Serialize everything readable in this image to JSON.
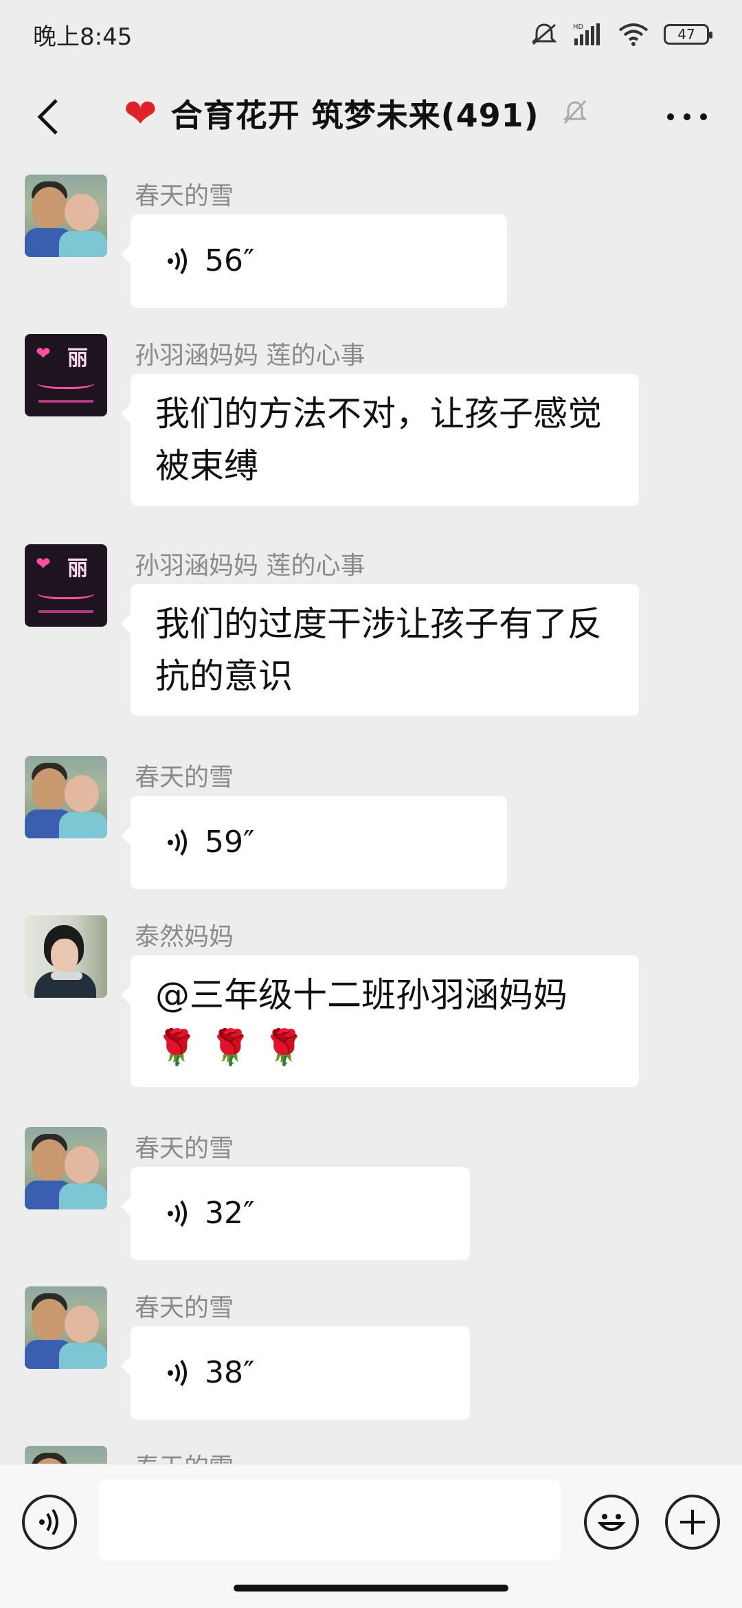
{
  "status_bar": {
    "time": "晚上8:45",
    "battery": "47"
  },
  "header": {
    "title": "合育花开 筑梦未来(491)"
  },
  "messages": [
    {
      "sender": "春天的雪",
      "type": "voice",
      "duration": "56″"
    },
    {
      "sender": "孙羽涵妈妈   莲的心事",
      "type": "text",
      "text": "我们的方法不对，让孩子感觉被束缚"
    },
    {
      "sender": "孙羽涵妈妈   莲的心事",
      "type": "text",
      "text": "我们的过度干涉让孩子有了反抗的意识"
    },
    {
      "sender": "春天的雪",
      "type": "voice",
      "duration": "59″"
    },
    {
      "sender": "泰然妈妈",
      "type": "text",
      "text": "@三年级十二班孙羽涵妈妈",
      "emoji": "🌹 🌹 🌹"
    },
    {
      "sender": "春天的雪",
      "type": "voice",
      "duration": "32″"
    },
    {
      "sender": "春天的雪",
      "type": "voice",
      "duration": "38″"
    },
    {
      "sender": "春天的雪",
      "type": "partial"
    }
  ],
  "input_bar": {
    "placeholder": ""
  },
  "icons": {
    "back": "back-arrow-icon",
    "mute": "bell-off-icon",
    "more": "more-dots-icon",
    "voice": "voice-icon",
    "emoji": "emoji-icon",
    "plus": "plus-icon"
  },
  "colors": {
    "background": "#ededed",
    "bubble": "#ffffff",
    "heart": "#e0202a"
  }
}
